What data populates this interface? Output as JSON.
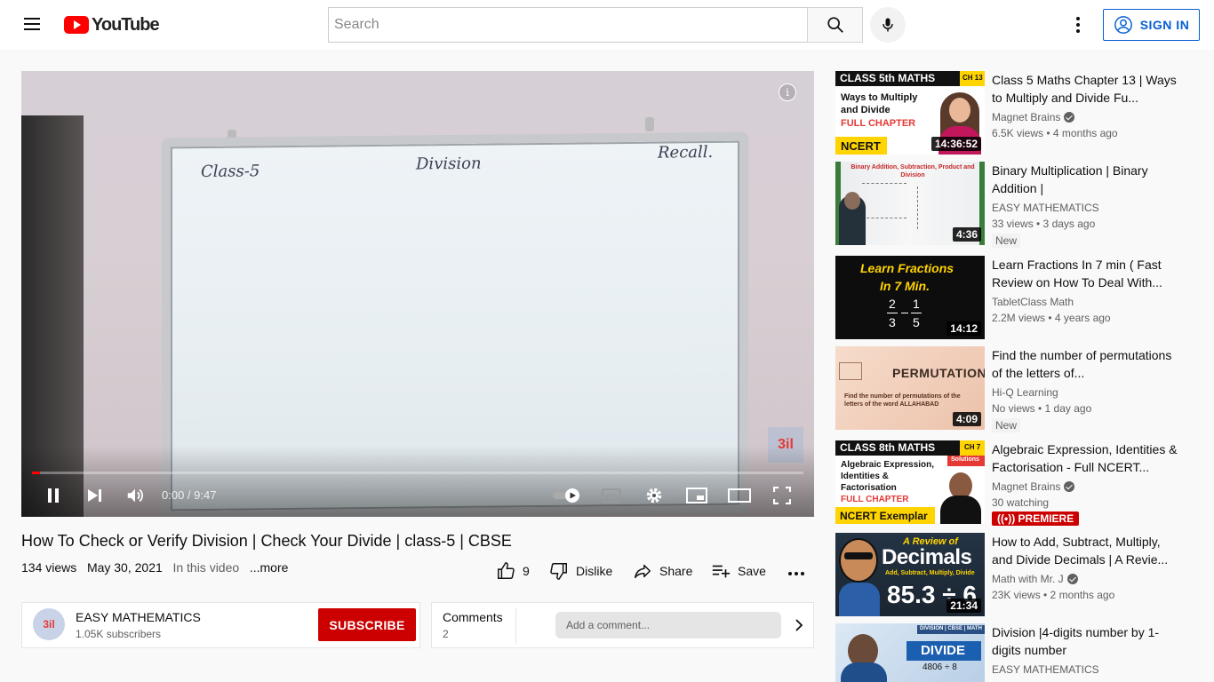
{
  "header": {
    "logo_text": "YouTube",
    "search_placeholder": "Search",
    "sign_in_label": "SIGN IN"
  },
  "player": {
    "board_text": [
      "Class-5",
      "Division",
      "Recall."
    ],
    "info_label": "i",
    "watermark": "3il",
    "time": "0:00 / 9:47",
    "progress": 0.01
  },
  "video": {
    "title": "How To Check or Verify Division | Check Your Divide | class-5 | CBSE",
    "views": "134 views",
    "date": "May 30, 2021",
    "description_preview": "In this video",
    "more_label": "...more",
    "likes": "9",
    "dislike_label": "Dislike",
    "share_label": "Share",
    "save_label": "Save"
  },
  "channel": {
    "name": "EASY MATHEMATICS",
    "subscribers": "1.05K subscribers",
    "avatar_text": "3il",
    "subscribe_label": "SUBSCRIBE"
  },
  "comments": {
    "label": "Comments",
    "count": "2",
    "placeholder": "Add a comment..."
  },
  "recommendations": [
    {
      "title": "Class 5 Maths Chapter 13 | Ways to Multiply and Divide Fu...",
      "channel": "Magnet Brains",
      "verified": true,
      "stats": "6.5K views • 4 months ago",
      "duration": "14:36:52",
      "thumb_text": [
        "CLASS 5th MATHS",
        "CH 13",
        "Ways to Multiply",
        "and Divide",
        "FULL CHAPTER",
        "NCERT"
      ]
    },
    {
      "title": "Binary Multiplication | Binary Addition |",
      "channel": "EASY MATHEMATICS",
      "verified": false,
      "stats": "33 views • 3 days ago",
      "duration": "4:36",
      "badge": "New",
      "thumb_text": [
        "Binary Addition, Subtraction, Product and Division"
      ]
    },
    {
      "title": "Learn Fractions In 7 min ( Fast Review on How To Deal With...",
      "channel": "TabletClass Math",
      "verified": false,
      "stats": "2.2M views • 4 years ago",
      "duration": "14:12",
      "thumb_text": [
        "Learn Fractions",
        "In 7 Min.",
        "2",
        "3",
        "1",
        "5"
      ]
    },
    {
      "title": "Find the number of permutations of the letters of...",
      "channel": "Hi-Q Learning",
      "verified": false,
      "stats": "No views • 1 day ago",
      "duration": "4:09",
      "badge": "New",
      "thumb_text": [
        "PERMUTATION",
        "Find the number of permutations of the letters of the word ALLAHABAD"
      ]
    },
    {
      "title": "Algebraic Expression, Identities & Factorisation - Full NCERT...",
      "channel": "Magnet Brains",
      "verified": true,
      "stats": "30 watching",
      "badge_premiere": "PREMIERE",
      "thumb_text": [
        "CLASS 8th MATHS",
        "CH 7",
        "Algebraic Expression,",
        "Identities &",
        "Factorisation",
        "FULL CHAPTER",
        "NCERT Exemplar",
        "Solutions"
      ]
    },
    {
      "title": "How to Add, Subtract, Multiply, and Divide Decimals | A Revie...",
      "channel": "Math with Mr. J",
      "verified": true,
      "stats": "23K views • 2 months ago",
      "duration": "21:34",
      "thumb_text": [
        "A Review of",
        "Decimals",
        "Add, Subtract, Multiply, Divide",
        "85.3 ÷ 6"
      ]
    },
    {
      "title": "Division |4-digits number by 1-digits number",
      "channel": "EASY MATHEMATICS",
      "verified": false,
      "thumb_text": [
        "DIVISION | CBSE | MATH",
        "DIVIDE",
        "4806 ÷ 8"
      ]
    }
  ]
}
